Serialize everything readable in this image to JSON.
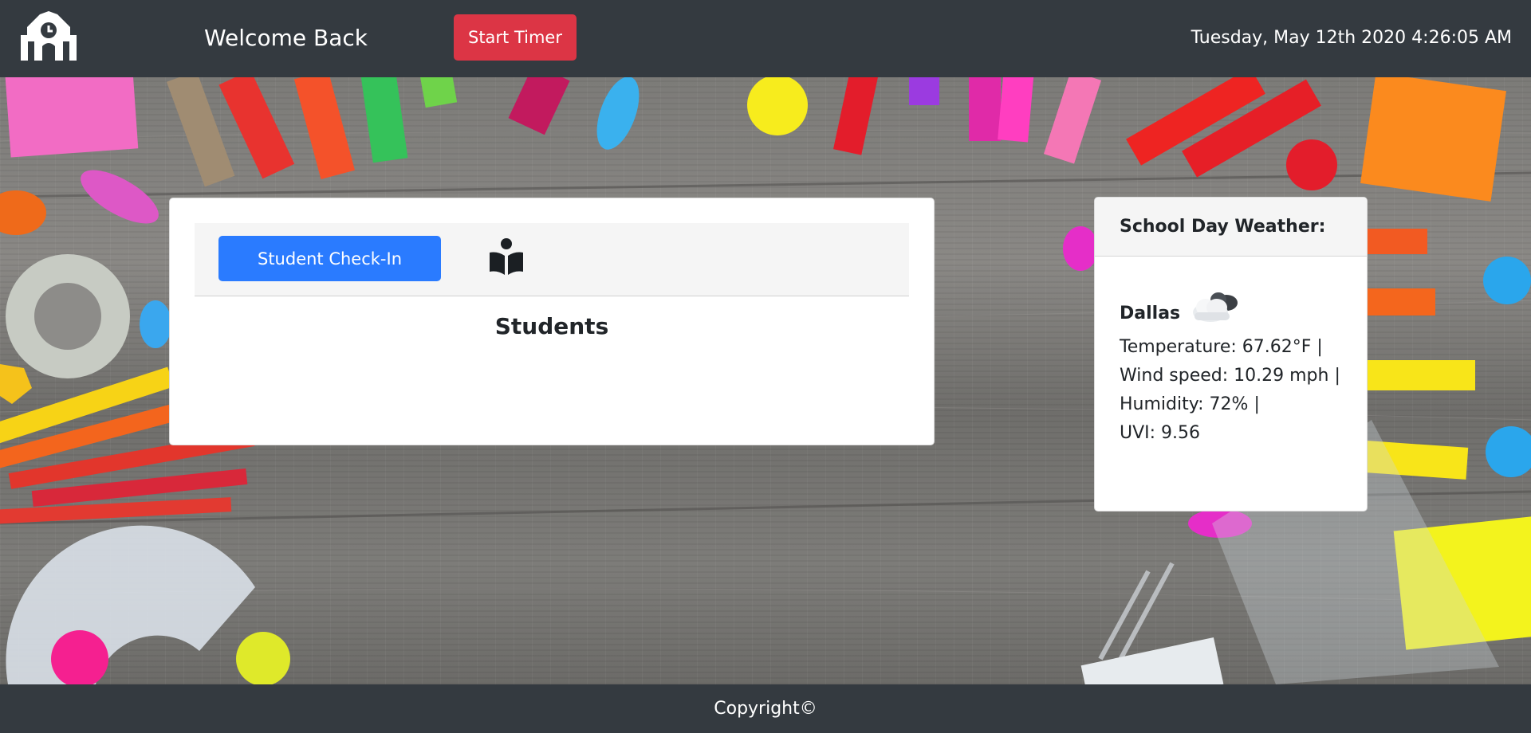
{
  "header": {
    "logo_icon": "school-clock-icon",
    "welcome_text": "Welcome Back",
    "timer_button": "Start Timer",
    "datetime": "Tuesday, May 12th 2020 4:26:05 AM"
  },
  "students_card": {
    "checkin_button": "Student Check-In",
    "reader_icon": "book-reader-icon",
    "title": "Students"
  },
  "weather_card": {
    "title": "School Day Weather:",
    "city": "Dallas",
    "icon": "cloudy-icon",
    "temperature": "Temperature: 67.62°F |",
    "wind": "Wind speed: 10.29 mph |",
    "humidity": "Humidity: 72% |",
    "uvi": "UVI: 9.56"
  },
  "footer": {
    "copyright": "Copyright©"
  },
  "colors": {
    "navbar": "#343a40",
    "timer_button": "#dc3545",
    "checkin_button": "#2a7bff",
    "card_header": "#f5f5f5"
  }
}
